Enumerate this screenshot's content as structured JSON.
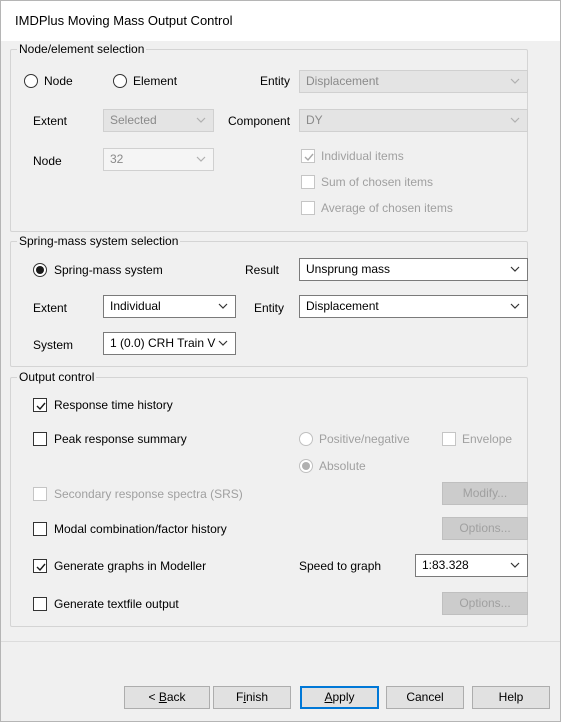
{
  "window": {
    "title": "IMDPlus Moving Mass Output Control"
  },
  "node_group": {
    "title": "Node/element selection",
    "radio_node": "Node",
    "radio_element": "Element",
    "entity_label": "Entity",
    "entity_value": "Displacement",
    "extent_label": "Extent",
    "extent_value": "Selected",
    "component_label": "Component",
    "component_value": "DY",
    "node_label": "Node",
    "node_value": "32",
    "individual_items": "Individual items",
    "sum_items": "Sum of chosen items",
    "average_items": "Average of chosen items"
  },
  "spring_group": {
    "title": "Spring-mass system selection",
    "radio_spring": "Spring-mass system",
    "result_label": "Result",
    "result_value": "Unsprung mass",
    "extent_label": "Extent",
    "extent_value": "Individual",
    "entity_label": "Entity",
    "entity_value": "Displacement",
    "system_label": "System",
    "system_value": "1 (0.0) CRH Train V"
  },
  "output_group": {
    "title": "Output control",
    "response_history": "Response time history",
    "peak_summary": "Peak response summary",
    "positive_negative": "Positive/negative",
    "envelope": "Envelope",
    "absolute": "Absolute",
    "srs": "Secondary response spectra (SRS)",
    "modify_button": "Modify...",
    "modal_combination": "Modal combination/factor history",
    "options_button_1": "Options...",
    "generate_graphs": "Generate graphs in Modeller",
    "speed_label": "Speed to graph",
    "speed_value": "1:83.328",
    "generate_textfile": "Generate textfile output",
    "options_button_2": "Options..."
  },
  "footer": {
    "back_prefix": "< ",
    "back_ul": "B",
    "back_rest": "ack",
    "finish_pre": "F",
    "finish_ul": "i",
    "finish_rest": "nish",
    "apply_ul": "A",
    "apply_rest": "pply",
    "cancel": "Cancel",
    "help": "Help"
  },
  "state": {
    "node_selected": false,
    "element_selected": false,
    "spring_selected": true,
    "response_history_checked": true,
    "peak_summary_checked": false,
    "individual_items_checked": true,
    "generate_graphs_checked": true
  },
  "colors": {
    "accent": "#0078d7",
    "window_bg": "#f0f0f0",
    "disabled_text": "#a0a0a0"
  }
}
